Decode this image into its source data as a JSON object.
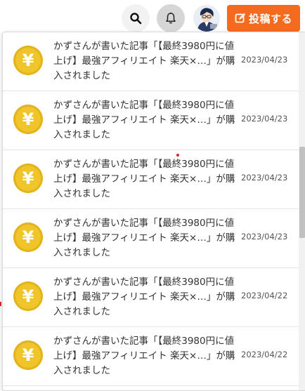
{
  "header": {
    "post_button_label": "投稿する"
  },
  "notifications": [
    {
      "message": "かずさんが書いた記事「【最終3980円に値上げ】最強アフィリエイト 楽天×…」が購入されました",
      "date": "2023/04/23"
    },
    {
      "message": "かずさんが書いた記事「【最終3980円に値上げ】最強アフィリエイト 楽天×…」が購入されました",
      "date": "2023/04/23"
    },
    {
      "message": "かずさんが書いた記事「【最終3980円に値上げ】最強アフィリエイト 楽天×…」が購入されました",
      "date": "2023/04/23"
    },
    {
      "message": "かずさんが書いた記事「【最終3980円に値上げ】最強アフィリエイト 楽天×…」が購入されました",
      "date": "2023/04/23"
    },
    {
      "message": "かずさんが書いた記事「【最終3980円に値上げ】最強アフィリエイト 楽天×…」が購入されました",
      "date": "2023/04/22"
    },
    {
      "message": "かずさんが書いた記事「【最終3980円に値上げ】最強アフィリエイト 楽天×…」が購入されました",
      "date": "2023/04/22"
    }
  ],
  "icons": {
    "coin": "¥",
    "search": "search-icon",
    "bell": "bell-icon",
    "edit": "edit-icon"
  },
  "colors": {
    "accent": "#f46a1f",
    "coin": "#f0c52a"
  }
}
